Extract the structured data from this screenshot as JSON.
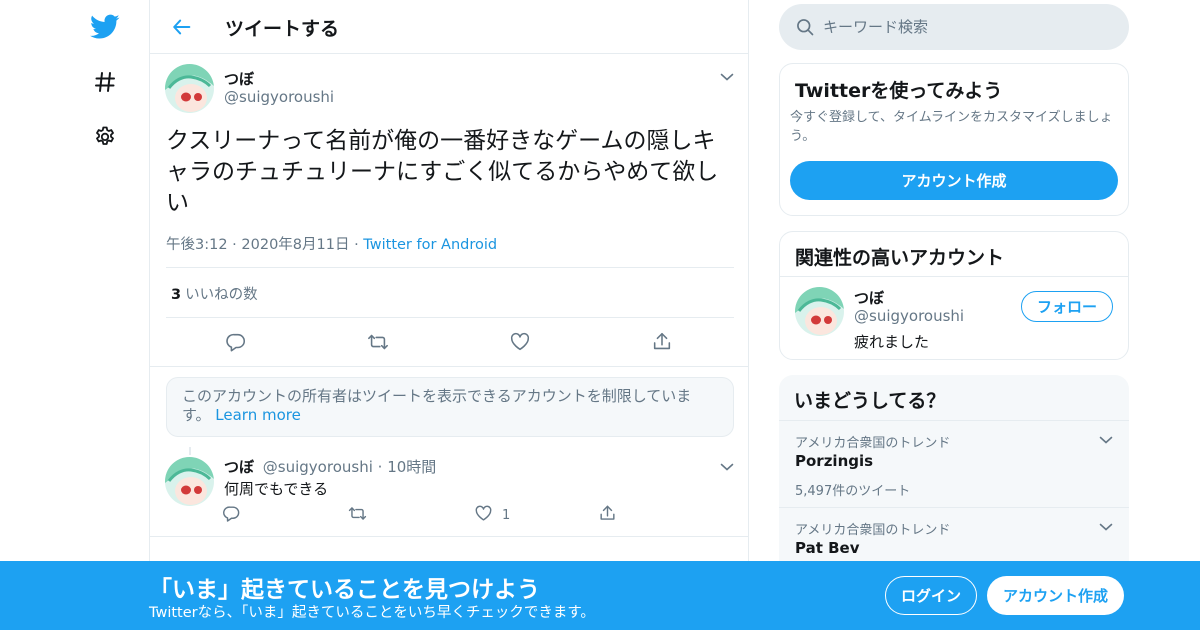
{
  "nav": {
    "logo_icon": "twitter-bird-icon",
    "explore_icon": "hashtag-icon",
    "settings_icon": "gear-icon"
  },
  "header": {
    "back_icon": "arrow-left-icon",
    "title": "ツイートする"
  },
  "tweet": {
    "author_name": "つぼ",
    "author_handle": "@suigyoroushi",
    "text": "クスリーナって名前が俺の一番好きなゲームの隠しキャラのチュチュリーナにすごく似てるからやめて欲しい",
    "time": "午後3:12",
    "date": "2020年8月11日",
    "separator": "·",
    "client": "Twitter for Android",
    "likes_count": "3",
    "likes_label": "いいねの数",
    "action_icons": [
      "reply-icon",
      "retweet-icon",
      "like-icon",
      "share-icon"
    ]
  },
  "notice": {
    "text": "このアカウントの所有者はツイートを表示できるアカウントを制限しています。",
    "link": "Learn more"
  },
  "reply": {
    "author_name": "つぼ",
    "author_handle": "@suigyoroushi",
    "separator": "·",
    "time": "10時間",
    "text": "何周でもできる",
    "like_count": "1"
  },
  "sidebar": {
    "search": {
      "placeholder": "キーワード検索"
    },
    "signup_card": {
      "title": "Twitterを使ってみよう",
      "subtitle": "今すぐ登録して、タイムラインをカスタマイズしましょう。",
      "button": "アカウント作成"
    },
    "related_card": {
      "title": "関連性の高いアカウント",
      "name": "つぼ",
      "handle": "@suigyoroushi",
      "bio": "疲れました",
      "follow_button": "フォロー"
    },
    "trends": {
      "title": "いまどうしてる？",
      "items": [
        {
          "context": "アメリカ合衆国のトレンド",
          "name": "Porzingis",
          "count": "5,497件のツイート"
        },
        {
          "context": "アメリカ合衆国のトレンド",
          "name": "Pat Bev"
        }
      ]
    }
  },
  "bottom_bar": {
    "title": "「いま」起きていることを見つけよう",
    "subtitle": "Twitterなら、「いま」起きていることをいち早くチェックできます。",
    "login": "ログイン",
    "signup": "アカウント作成"
  },
  "colors": {
    "accent": "#1da1f2",
    "link": "#1b95e0",
    "secondary_text": "#657786",
    "border": "#e6ecf0",
    "panel": "#f5f8fa"
  }
}
